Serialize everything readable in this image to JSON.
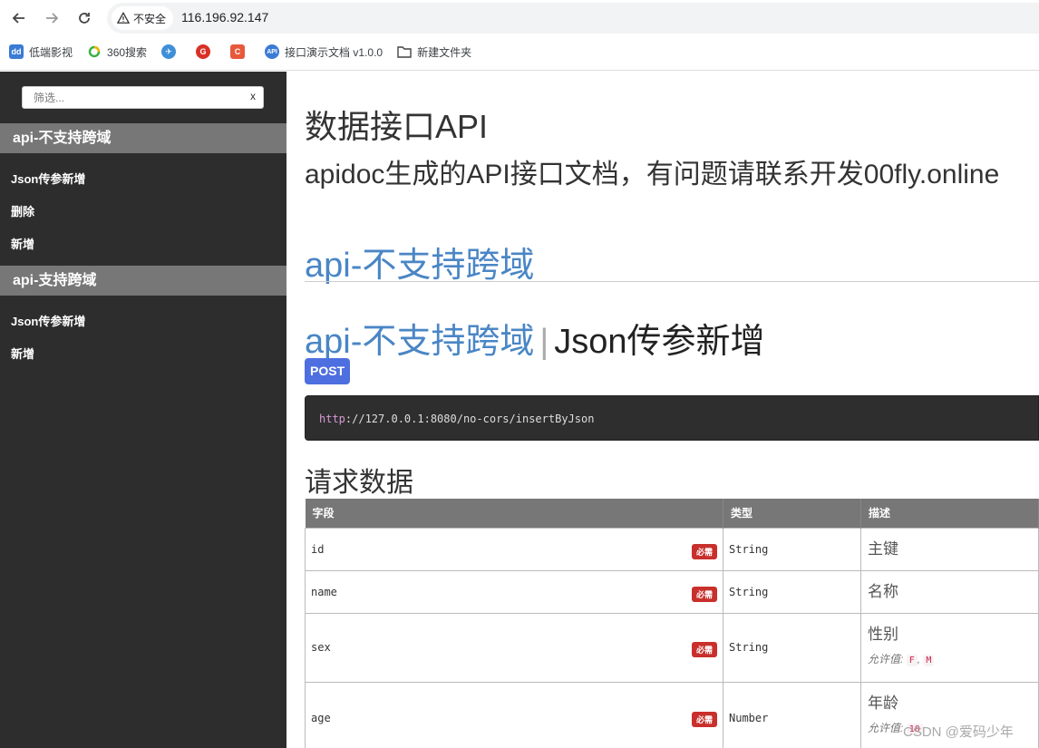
{
  "browser": {
    "security_label": "不安全",
    "url": "116.196.92.147",
    "bookmarks": [
      {
        "label": "低端影视",
        "icon": "dd-icon"
      },
      {
        "label": "360搜索",
        "icon": "360-icon"
      },
      {
        "label": "",
        "icon": "plane-icon"
      },
      {
        "label": "",
        "icon": "g-icon"
      },
      {
        "label": "",
        "icon": "c-icon"
      },
      {
        "label": "接口演示文档 v1.0.0",
        "icon": "api-icon"
      },
      {
        "label": "新建文件夹",
        "icon": "folder-icon"
      }
    ]
  },
  "sidebar": {
    "filter_placeholder": "筛选...",
    "filter_clear": "x",
    "groups": [
      {
        "title": "api-不支持跨域",
        "items": [
          "Json传参新增",
          "删除",
          "新增"
        ]
      },
      {
        "title": "api-支持跨域",
        "items": [
          "Json传参新增",
          "新增"
        ]
      }
    ]
  },
  "main": {
    "title": "数据接口API",
    "subtitle": "apidoc生成的API接口文档，有问题请联系开发00fly.online",
    "group_title": "api-不支持跨域",
    "endpoint": {
      "group": "api-不支持跨域",
      "separator": "|",
      "name": "Json传参新增",
      "method": "POST",
      "url_proto": "http",
      "url_rest": "://127.0.0.1:8080/no-cors/insertByJson"
    },
    "request_title": "请求数据",
    "table": {
      "headers": [
        "字段",
        "类型",
        "描述"
      ],
      "required_label": "必需",
      "allowed_label": "允许值:",
      "rows": [
        {
          "field": "id",
          "type": "String",
          "desc": "主键",
          "allowed": []
        },
        {
          "field": "name",
          "type": "String",
          "desc": "名称",
          "allowed": []
        },
        {
          "field": "sex",
          "type": "String",
          "desc": "性别",
          "allowed": [
            "F",
            "M"
          ]
        },
        {
          "field": "age",
          "type": "Number",
          "desc": "年龄",
          "allowed": [
            "10"
          ]
        }
      ]
    }
  },
  "watermark": "CSDN @爱码少年"
}
